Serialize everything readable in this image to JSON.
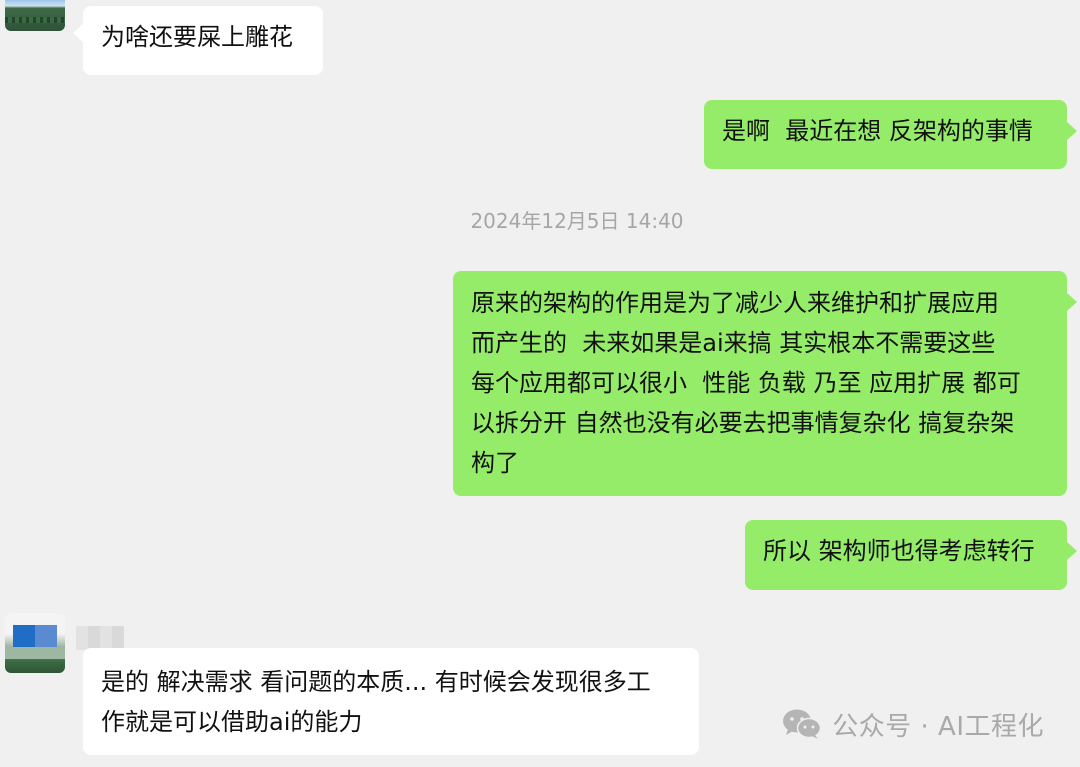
{
  "messages": [
    {
      "side": "in",
      "text": "为啥还要屎上雕花"
    },
    {
      "side": "out",
      "text": "是啊  最近在想 反架构的事情"
    },
    {
      "side": "out",
      "lines": [
        "原来的架构的作用是为了减少人来维护和扩展应用",
        "而产生的  未来如果是ai来搞 其实根本不需要这些",
        "每个应用都可以很小  性能 负载 乃至 应用扩展 都可",
        "以拆分开 自然也没有必要去把事情复杂化 搞复杂架",
        "构了"
      ]
    },
    {
      "side": "out",
      "text": "所以 架构师也得考虑转行"
    },
    {
      "side": "in",
      "lines": [
        "是的 解决需求 看问题的本质... 有时候会发现很多工",
        "作就是可以借助ai的能力"
      ]
    }
  ],
  "timestamp": "2024年12月5日 14:40",
  "watermark": {
    "icon": "wechat-icon",
    "text": "公众号 · AI工程化"
  },
  "colors": {
    "background": "#f0f0f0",
    "bubble_out": "#95ec69",
    "bubble_in": "#ffffff",
    "timestamp": "#a6a6a6",
    "watermark": "#a9a9a9"
  }
}
